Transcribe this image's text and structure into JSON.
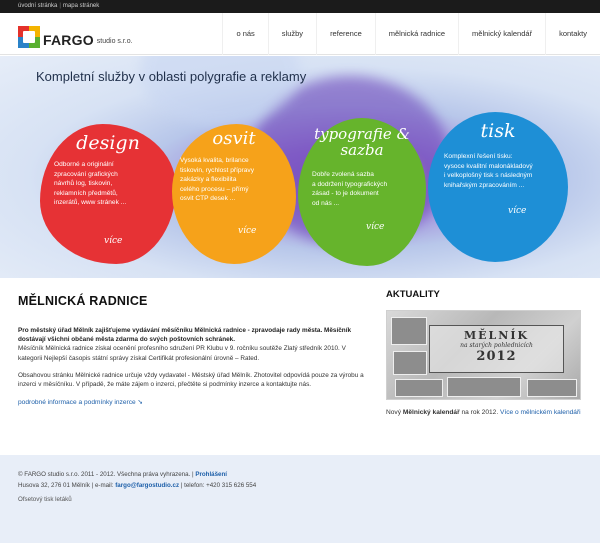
{
  "utility": {
    "home": "úvodní stránka",
    "sep": "|",
    "sitemap": "mapa stránek"
  },
  "brand": {
    "name": "FARGO",
    "sub": "studio s.r.o."
  },
  "nav": [
    "o nás",
    "služby",
    "reference",
    "mělnická radnice",
    "mělnický kalendář",
    "kontakty"
  ],
  "hero": {
    "title": "Kompletní služby v oblasti polygrafie a reklamy",
    "cards": [
      {
        "title": "design",
        "text": [
          "Odborné a originální",
          "zpracování grafických",
          "návrhů log, tiskovin,",
          "reklamních předmětů,",
          "inzerátů, www stránek ..."
        ],
        "more": "více",
        "color": "#e63235"
      },
      {
        "title": "osvit",
        "text": [
          "Vysoká kvalita, brilance",
          "tiskovin, rychlost přípravy",
          "zakázky a flexibilita",
          "celého procesu – přímý",
          "osvit CTP desek ..."
        ],
        "more": "více",
        "color": "#f6a21a"
      },
      {
        "title": "typografie & sazba",
        "text": [
          "Dobře zvolená sazba",
          "a dodržení typografických",
          "zásad - to je dokument",
          "od nás ..."
        ],
        "more": "více",
        "color": "#66b42c"
      },
      {
        "title": "tisk",
        "text": [
          "Komplexní řešení tisku:",
          "vysoce kvalitní malonákladový",
          "i velkoplošný tisk s následným",
          "knihařským zpracováním ..."
        ],
        "more": "více",
        "color": "#1e8fd6"
      }
    ]
  },
  "main": {
    "heading": "MĚLNICKÁ RADNICE",
    "lead": "Pro městský úřad Mělník zajišťujeme vydávání měsíčníku Mělnická radnice - zpravodaje rady města. Měsíčník dostávají všichni občané města zdarma do svých poštovních schránek.",
    "para1": "Měsíčník Mělnická radnice získal ocenění profesního sdružení PR Klubu v 9. ročníku soutěže Zlatý středník 2010. V kategorii Nejlepší časopis státní správy získal Certifikát profesionální úrovně – Rated.",
    "para2": "Obsahovou stránku Mělnické radnice určuje vždy vydavatel - Městský úřad Mělník. Zhotovitel odpovídá pouze za výrobu a inzerci v měsíčníku. V případě, že máte zájem o inzerci, přečtěte si podmínky inzerce a kontaktujte nás.",
    "more_link": "podrobné informace a podmínky inzerce"
  },
  "news": {
    "heading": "AKTUALITY",
    "photo": {
      "title": "MĚLNÍK",
      "subtitle": "na starých pohlednicích",
      "year": "2012"
    },
    "caption_prefix": "Nový ",
    "caption_bold": "Mělnický kalendář",
    "caption_mid": " na rok 2012. ",
    "caption_link": "Více o mělnickém kalendáři"
  },
  "footer": {
    "copyright": "© FARGO studio s.r.o. 2011 - 2012. Všechna práva vyhrazena.",
    "login": "Prohlášení",
    "address": "Husova 32, 276 01 Mělník",
    "email_label": "e-mail:",
    "email": "fargo@fargostudio.cz",
    "phone": "telefon: +420 315 626 554",
    "extra": "Ofsetový tisk letáků"
  }
}
